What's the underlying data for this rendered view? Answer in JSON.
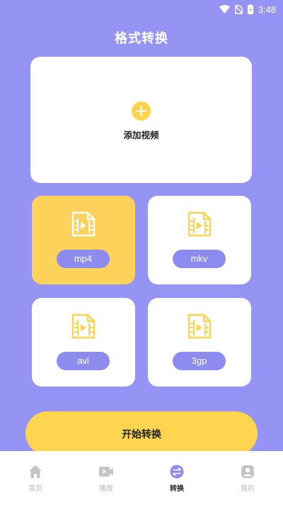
{
  "status_bar": {
    "time": "3:48"
  },
  "page_title": "格式转换",
  "add_video": {
    "label": "添加视频"
  },
  "formats": [
    {
      "label": "mp4",
      "selected": true
    },
    {
      "label": "mkv",
      "selected": false
    },
    {
      "label": "avi",
      "selected": false
    },
    {
      "label": "3gp",
      "selected": false
    }
  ],
  "start_button": {
    "label": "开始转换"
  },
  "tab_bar": {
    "items": [
      {
        "label": "首页",
        "icon": "home-icon",
        "active": false
      },
      {
        "label": "播放",
        "icon": "video-camera-icon",
        "active": false
      },
      {
        "label": "转换",
        "icon": "convert-icon",
        "active": true
      },
      {
        "label": "我的",
        "icon": "profile-icon",
        "active": false
      }
    ]
  },
  "colors": {
    "background": "#9594f4",
    "accent_yellow": "#fdd24f",
    "pill": "#8d8cee",
    "tab_inactive": "#c4c4c4",
    "tab_active": "#8d8cee"
  }
}
